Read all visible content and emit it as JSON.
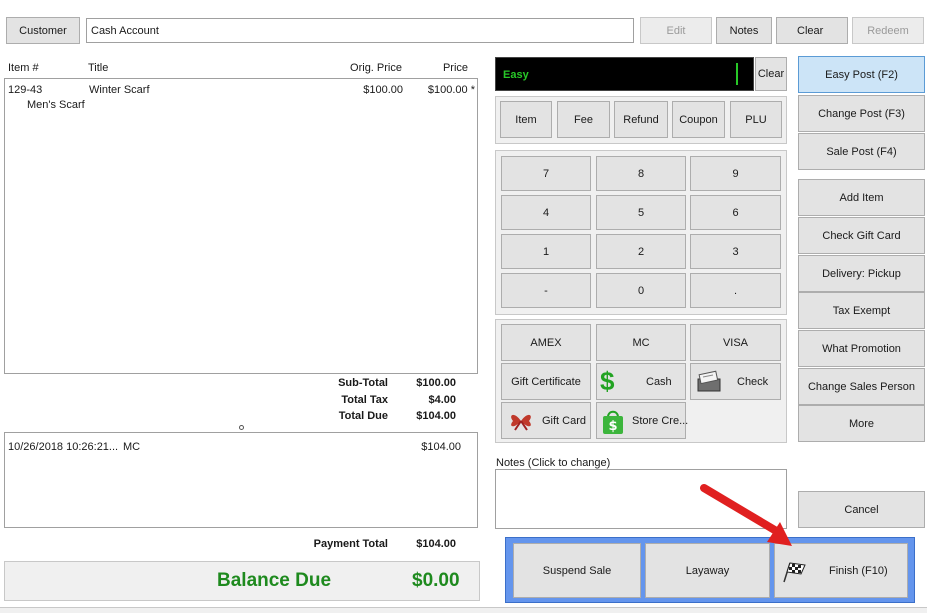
{
  "top": {
    "customer_button": "Customer",
    "customer_value": "Cash Account",
    "edit_button": "Edit",
    "notes_button": "Notes",
    "clear_button": "Clear",
    "redeem_button": "Redeem"
  },
  "items_table": {
    "headers": {
      "item": "Item #",
      "title": "Title",
      "orig_price": "Orig. Price",
      "price": "Price"
    },
    "rows": [
      {
        "item": "129-43",
        "title": "Winter Scarf",
        "subtitle": "Men's Scarf",
        "orig_price": "$100.00",
        "price": "$100.00 *"
      }
    ]
  },
  "totals": {
    "subtotal_label": "Sub-Total",
    "subtotal_value": "$100.00",
    "tax_label": "Total Tax",
    "tax_value": "$4.00",
    "due_label": "Total Due",
    "due_value": "$104.00"
  },
  "payments": {
    "rows": [
      {
        "date": "10/26/2018 10:26:21...",
        "method": "MC",
        "amount": "$104.00"
      }
    ],
    "total_label": "Payment Total",
    "total_value": "$104.00"
  },
  "balance": {
    "label": "Balance Due",
    "value": "$0.00",
    "color": "#1e8a1e"
  },
  "entry": {
    "mode": "Easy",
    "clear_button": "Clear"
  },
  "modes": [
    "Item",
    "Fee",
    "Refund",
    "Coupon",
    "PLU"
  ],
  "keypad": [
    "7",
    "8",
    "9",
    "4",
    "5",
    "6",
    "1",
    "2",
    "3",
    "-",
    "0",
    "."
  ],
  "tenders": {
    "amex": "AMEX",
    "mc": "MC",
    "visa": "VISA",
    "gift_certificate": "Gift Certificate",
    "cash": "Cash",
    "check": "Check",
    "gift_card": "Gift Card",
    "store_credit": "Store Cre..."
  },
  "notes_label": "Notes (Click to change)",
  "right_buttons": {
    "easy_post": "Easy Post (F2)",
    "change_post": "Change Post (F3)",
    "sale_post": "Sale Post (F4)",
    "add_item": "Add Item",
    "check_gift_card": "Check Gift Card",
    "delivery": "Delivery: Pickup",
    "tax_exempt": "Tax Exempt",
    "what_promotion": "What Promotion",
    "change_sales_person": "Change Sales Person",
    "more": "More",
    "cancel": "Cancel"
  },
  "bottom_bar": {
    "suspend_sale": "Suspend Sale",
    "layaway": "Layaway",
    "finish": "Finish (F10)",
    "bar_color": "#6495ed"
  },
  "accent_arrow_color": "#e02020"
}
